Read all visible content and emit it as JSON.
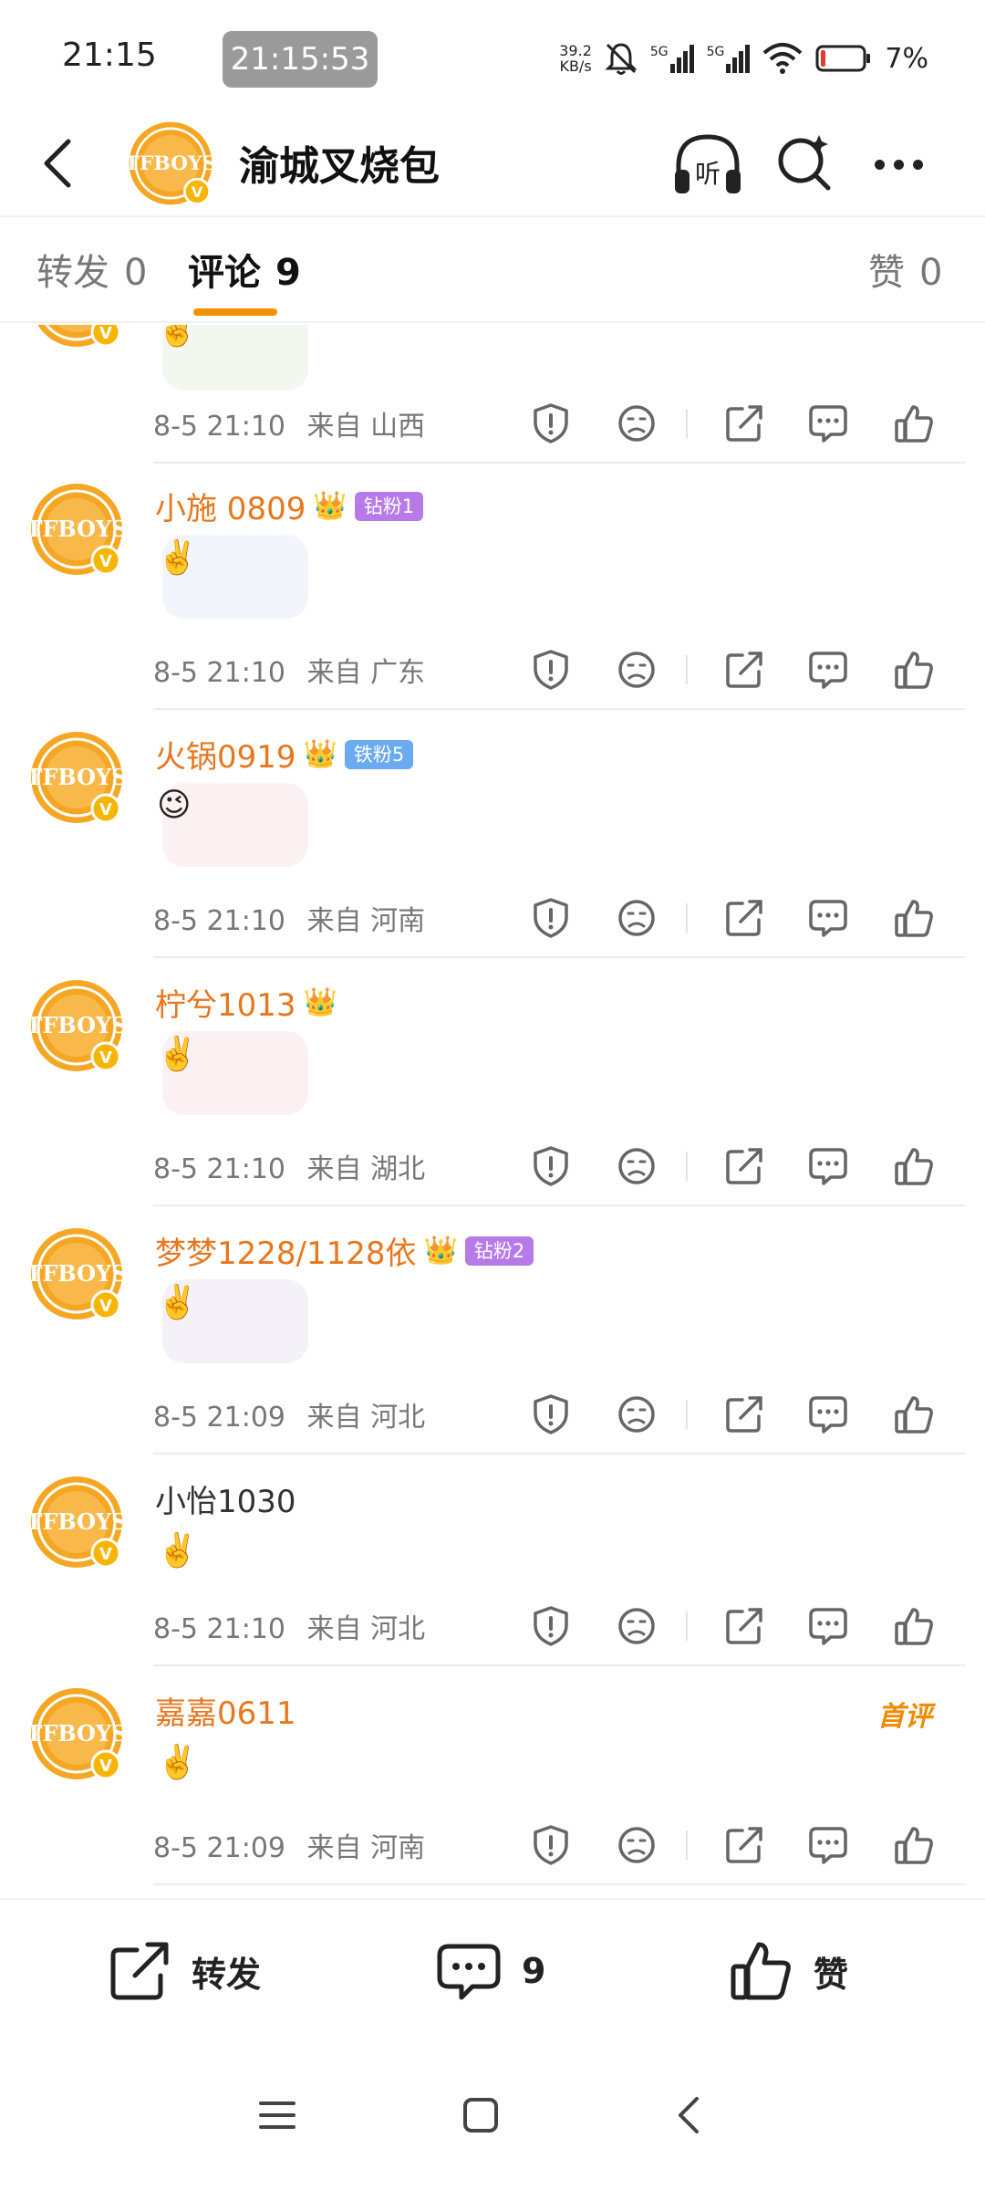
{
  "status_bar": {
    "time": "21:15",
    "pill_time": "21:15:53",
    "net_speed_value": "39.2",
    "net_speed_unit": "KB/s",
    "sim1": "5G",
    "sim2": "5G",
    "battery": "7%"
  },
  "header": {
    "title": "渝城叉烧包",
    "listen_label": "听",
    "icons": [
      "back-icon",
      "headphones-icon",
      "search-icon",
      "more-icon"
    ]
  },
  "tabs": [
    {
      "label": "转发",
      "count": "0"
    },
    {
      "label": "评论",
      "count": "9"
    },
    {
      "label": "赞",
      "count": "0"
    }
  ],
  "comments": [
    {
      "user": "",
      "date": "8-5 21:10",
      "from": "来自 山西",
      "gesture": "✌️",
      "sticker": "green"
    },
    {
      "user": "小施 0809",
      "badge": "钻粉1",
      "badge_color": "#b67be8",
      "date": "8-5 21:10",
      "from": "来自 广东",
      "gesture": "✌️",
      "sticker": "blue"
    },
    {
      "user": "火锅0919",
      "badge": "铁粉5",
      "badge_color": "#6aaaf0",
      "date": "8-5 21:10",
      "from": "来自 河南",
      "gesture": "😉",
      "sticker": "pink"
    },
    {
      "user": "柠兮1013",
      "date": "8-5 21:10",
      "from": "来自 湖北",
      "gesture": "✌️",
      "sticker": "pink"
    },
    {
      "user": "梦梦1228/1128依",
      "badge": "钻粉2",
      "badge_color": "#b67be8",
      "date": "8-5 21:09",
      "from": "来自 河北",
      "gesture": "✌️",
      "sticker": "lilac"
    },
    {
      "user": "小怡1030",
      "date": "8-5 21:10",
      "from": "来自 河北",
      "gesture": "✌️"
    },
    {
      "user": "嘉嘉0611",
      "tag": "首评",
      "date": "8-5 21:09",
      "from": "来自 河南",
      "gesture": "✌️"
    }
  ],
  "action_icons": [
    "report-icon",
    "dislike-face-icon",
    "share-icon",
    "reply-icon",
    "like-icon"
  ],
  "bottom_bar": {
    "repost_label": "转发",
    "comment_count": "9",
    "like_label": "赞"
  },
  "colors": {
    "accent": "#f29100",
    "username": "#e8761c",
    "badge_diamond": "#b67be8",
    "badge_iron": "#6aaaf0"
  }
}
